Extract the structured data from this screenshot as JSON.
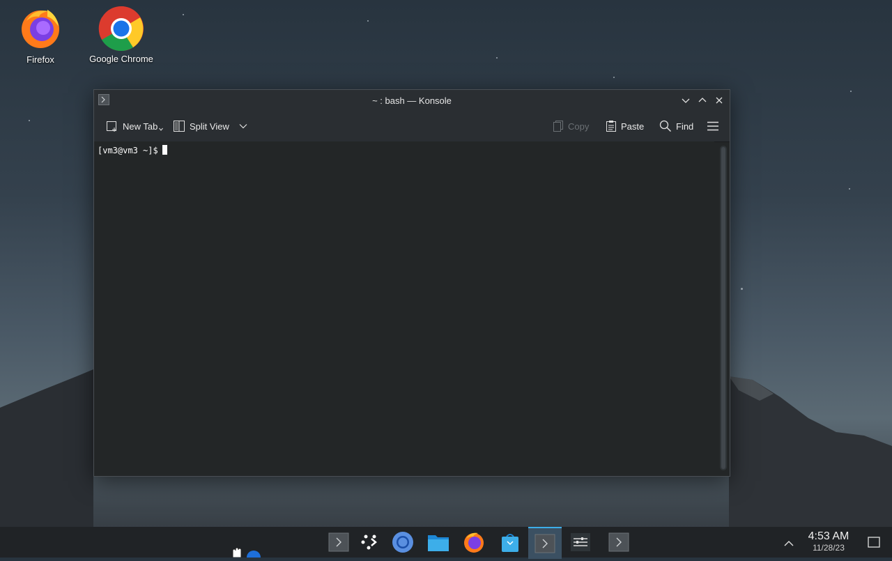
{
  "desktop": {
    "icons": [
      {
        "label": "Firefox",
        "icon": "firefox-icon"
      },
      {
        "label": "Google Chrome",
        "icon": "chrome-icon"
      }
    ]
  },
  "window": {
    "title": "~ : bash — Konsole",
    "app_icon": "konsole-icon",
    "controls": [
      "minimize-icon",
      "maximize-icon",
      "close-icon"
    ]
  },
  "toolbar": {
    "new_tab_label": "New Tab",
    "split_view_label": "Split View",
    "copy_label": "Copy",
    "paste_label": "Paste",
    "find_label": "Find",
    "menu_icon": "hamburger-menu-icon"
  },
  "terminal": {
    "prompt": "[vm3@vm3 ~]$"
  },
  "taskbar": {
    "items": [
      "konsole-icon",
      "kde-connect-icon",
      "chromium-icon",
      "files-icon",
      "firefox-icon",
      "discover-icon",
      "konsole-active-icon",
      "settings-icon",
      "konsole-icon"
    ],
    "time": "4:53 AM",
    "date": "11/28/23"
  },
  "colors": {
    "accent": "#3daee9",
    "terminal_bg": "#232627",
    "titlebar_bg": "#2a2e32"
  }
}
